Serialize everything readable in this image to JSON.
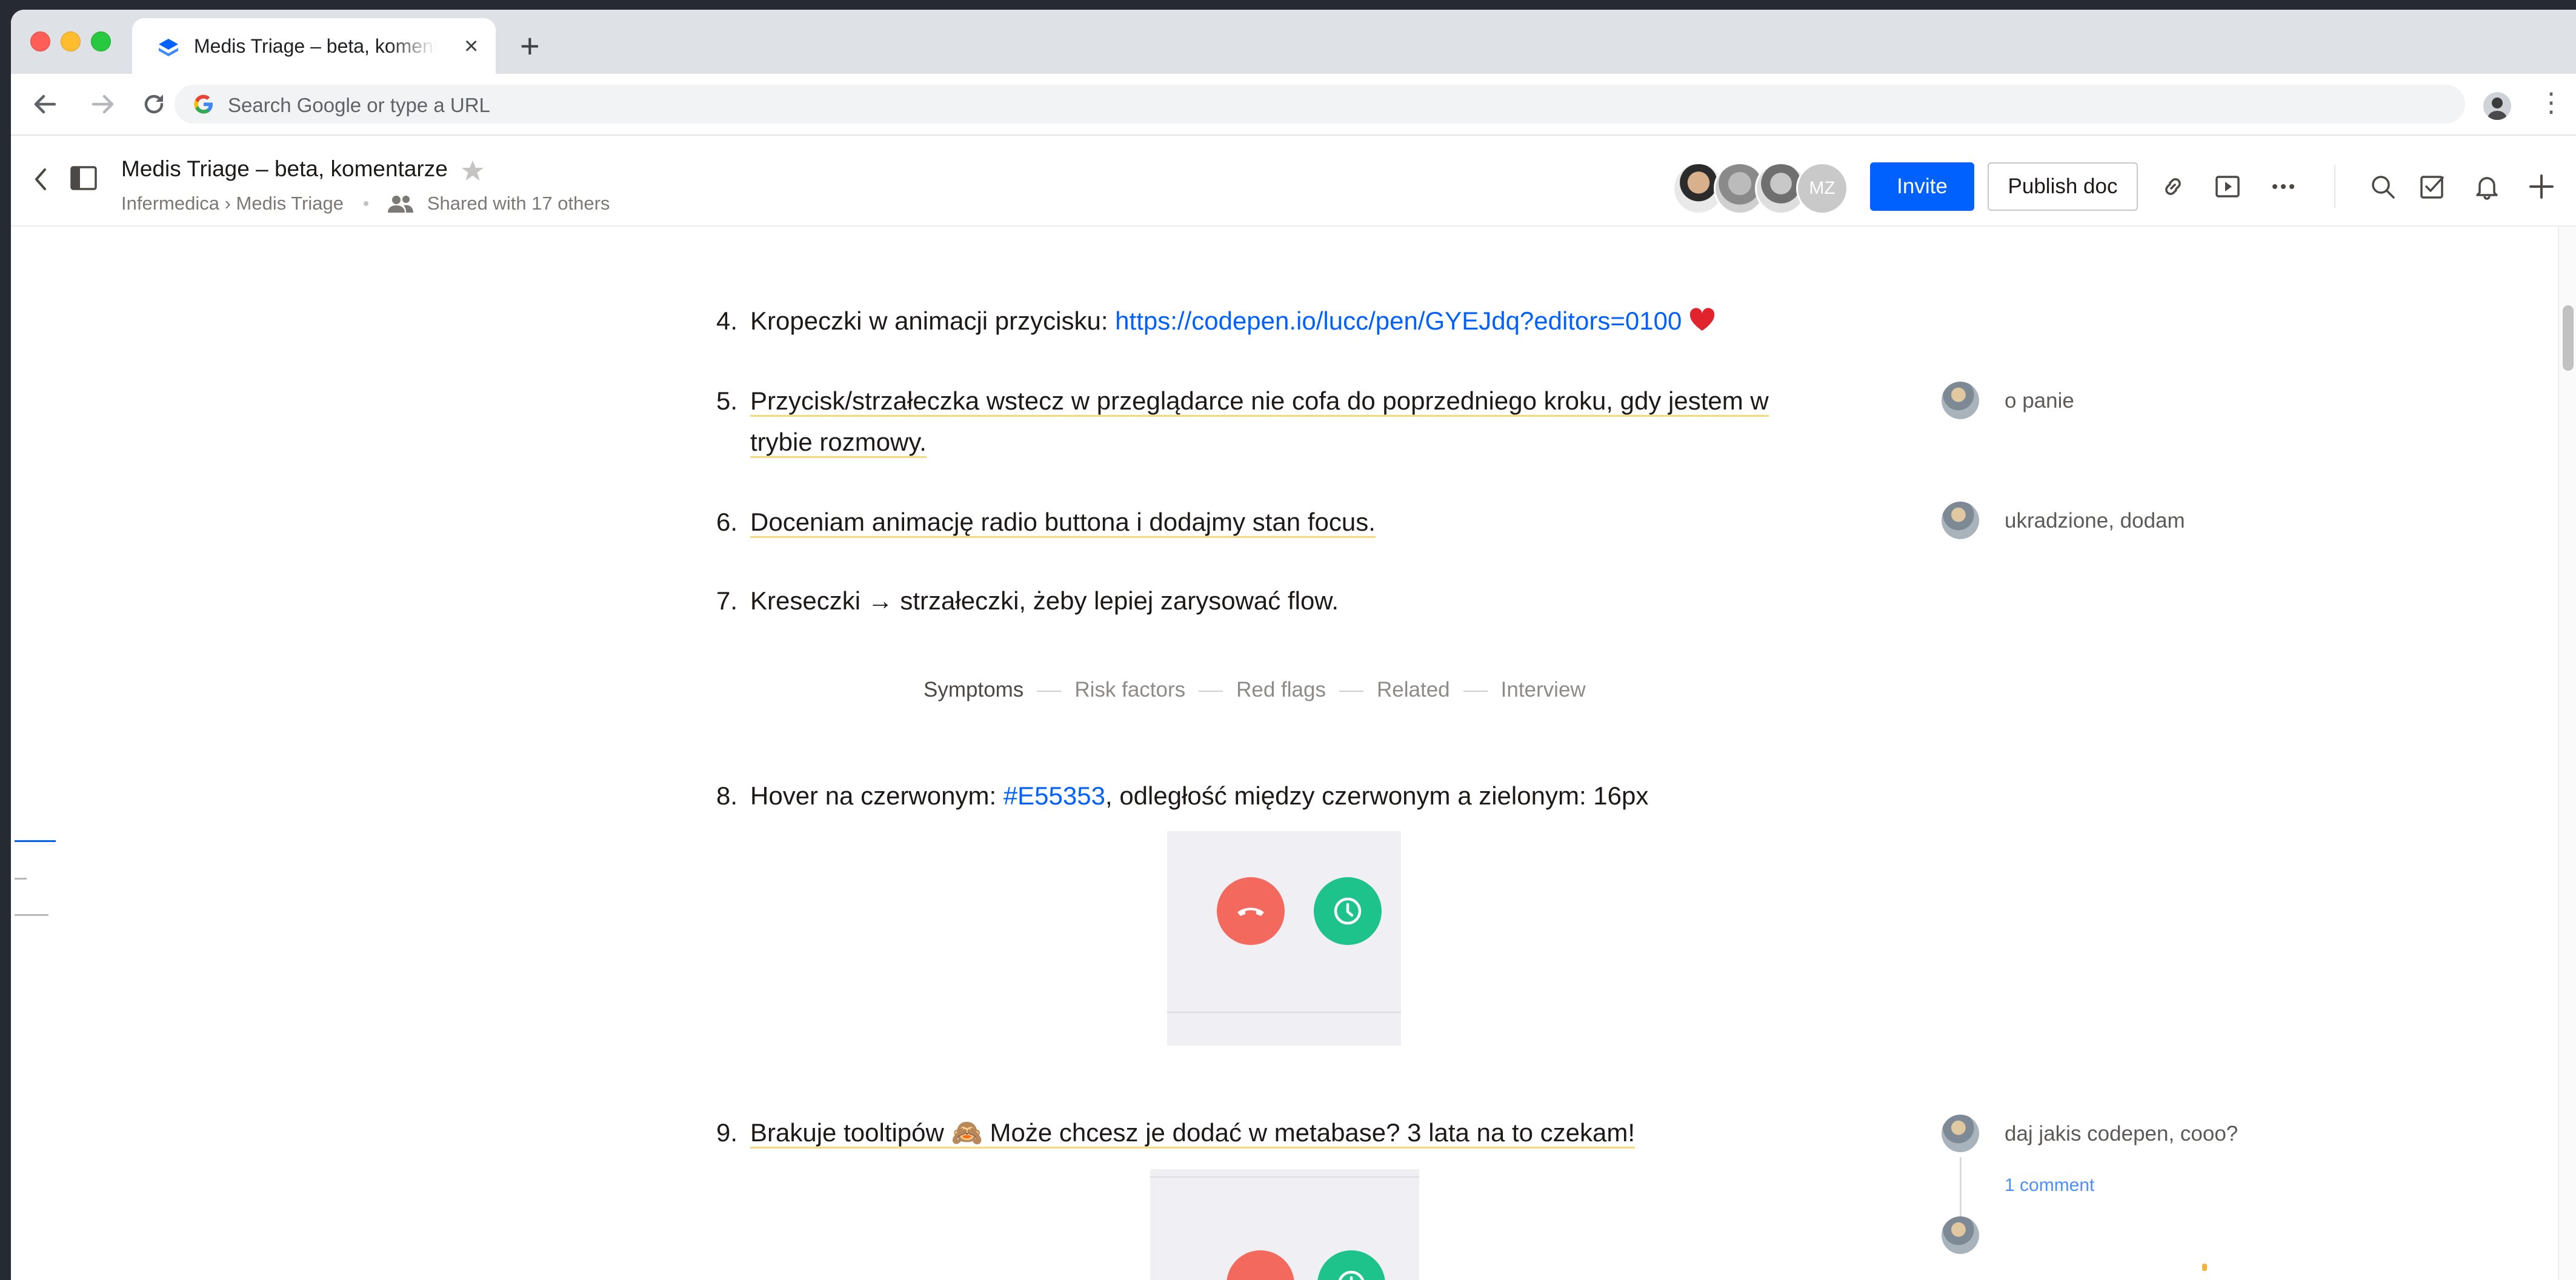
{
  "browser": {
    "tab_title": "Medis Triage – beta, komentarze",
    "tab_close": "×",
    "new_tab": "+",
    "omnibox_placeholder": "Search Google or type a URL"
  },
  "header": {
    "title": "Medis Triage – beta, komentarze",
    "breadcrumb": "Infermedica › Medis Triage",
    "shared": "Shared with 17 others",
    "avatar_initials": "MZ",
    "invite_label": "Invite",
    "publish_label": "Publish doc",
    "accent": "#0061fe"
  },
  "doc": {
    "items": [
      {
        "num": "4.",
        "text": "Kropeczki w animacji przycisku: ",
        "link": "https://codepen.io/lucc/pen/GYEJdq?editors=0100"
      },
      {
        "num": "5.",
        "text": "Przycisk/strzałeczka wstecz w przeglądarce nie cofa do poprzedniego kroku, gdy jestem w",
        "text2": "trybie rozmowy."
      },
      {
        "num": "6.",
        "text": "Doceniam animację radio buttona i dodajmy stan focus."
      },
      {
        "num": "7.",
        "text": "Kreseczki → strzałeczki, żeby lepiej zarysować flow."
      },
      {
        "num": "8.",
        "text": "Hover na czerwonym: ",
        "link": "#E55353",
        "text_after": ", odległość między czerwonym a zielonym: 16px"
      },
      {
        "num": "9.",
        "text": "Brakuje tooltipów 🙈 Może chcesz je dodać w metabase? 3 lata na to czekam!"
      }
    ],
    "steps": [
      "Symptoms",
      "Risk factors",
      "Red flags",
      "Related",
      "Interview"
    ],
    "hover_color": "#E55353",
    "red_button_color": "#f4695d",
    "green_button_color": "#1ec28b"
  },
  "comments": [
    {
      "text": "o panie"
    },
    {
      "text": "ukradzione, dodam"
    },
    {
      "text": "daj jakis codepen, cooo?",
      "link": "1 comment"
    }
  ]
}
